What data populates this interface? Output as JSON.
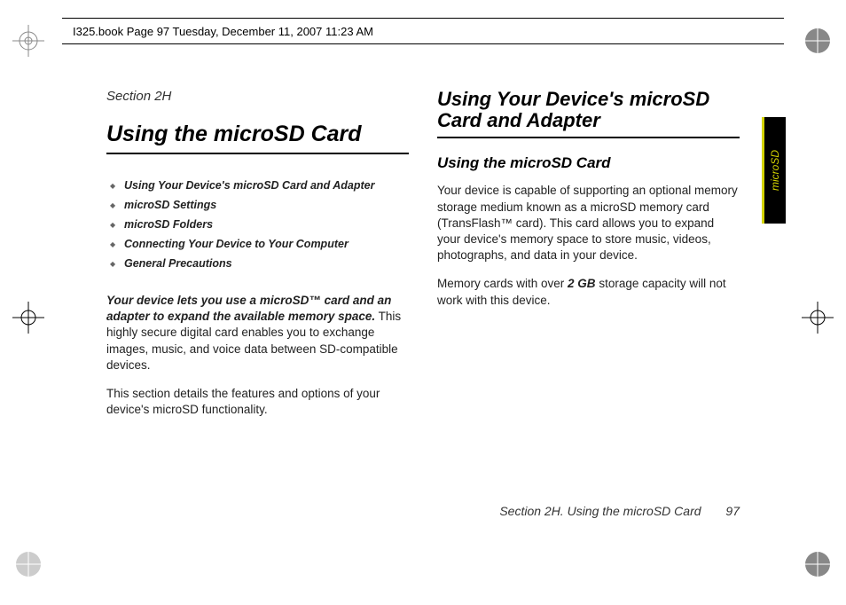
{
  "header": {
    "text": "I325.book  Page 97  Tuesday, December 11, 2007  11:23 AM"
  },
  "sideTab": {
    "label": "microSD"
  },
  "leftColumn": {
    "sectionLabel": "Section 2H",
    "title": "Using the microSD Card",
    "toc": [
      "Using Your Device's microSD Card and Adapter",
      "microSD Settings",
      "microSD Folders",
      "Connecting Your Device to Your Computer",
      "General Precautions"
    ],
    "introLead": "Your device lets you use a microSD™ card and an adapter to expand the available memory space.",
    "introRest": " This highly secure digital card enables you to exchange images, music, and voice data between SD-compatible devices.",
    "introPara2": "This section details the features and options of your device's microSD functionality."
  },
  "rightColumn": {
    "title": "Using Your Device's microSD Card and Adapter",
    "subheading": "Using the microSD Card",
    "para1": "Your device is capable of supporting an optional memory storage medium known as a microSD memory card (TransFlash™ card). This card allows you to expand your device's memory space to store music, videos, photographs, and data in your device.",
    "para2a": "Memory cards with over ",
    "para2bold": "2 GB",
    "para2b": " storage capacity will not work with this device."
  },
  "footer": {
    "text": "Section 2H. Using the microSD Card",
    "pageNum": "97"
  }
}
